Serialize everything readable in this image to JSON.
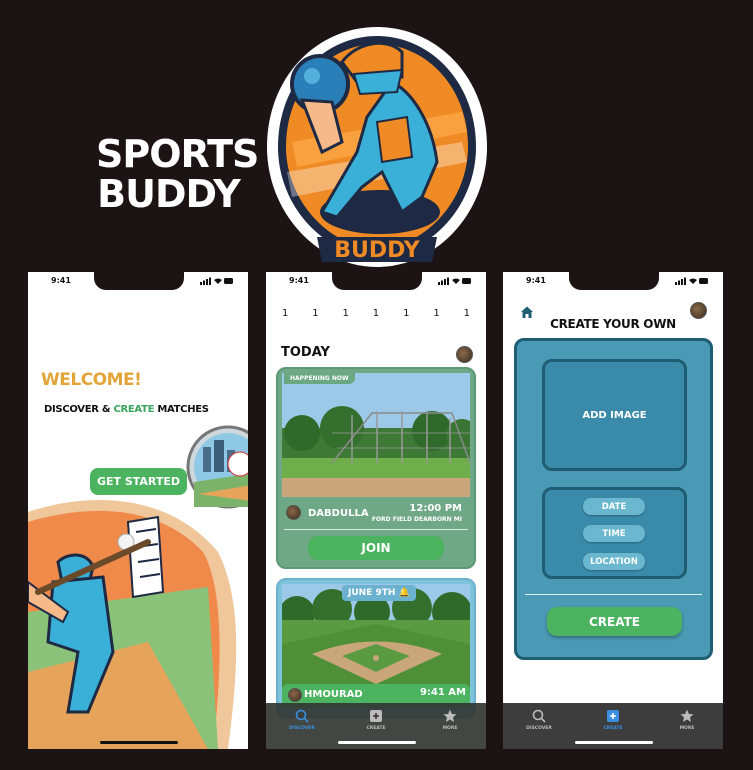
{
  "brand": {
    "title_line1": "SPORTS",
    "title_line2": "BUDDY",
    "logo_text": "BUDDY",
    "logo_colors": {
      "orange": "#f08a24",
      "blue": "#3ab0d8",
      "navy": "#1e2a44"
    }
  },
  "status_bar": {
    "time": "9:41"
  },
  "welcome_screen": {
    "heading": "WELCOME!",
    "tagline_part1": "DISCOVER & ",
    "tagline_highlight": "CREATE",
    "tagline_part2": " MATCHES",
    "cta_label": "GET STARTED"
  },
  "discover_screen": {
    "days": [
      "1",
      "1",
      "1",
      "1",
      "1",
      "1",
      "1"
    ],
    "section_title": "TODAY",
    "events": [
      {
        "badge": "HAPPENING NOW",
        "host": "DABDULLA",
        "time": "12:00 PM",
        "location": "FORD FIELD DEARBORN MI",
        "action_label": "JOIN"
      },
      {
        "date_label": "JUNE 9TH",
        "host": "HMOURAD",
        "time": "9:41 AM"
      }
    ]
  },
  "create_screen": {
    "title": "CREATE YOUR OWN",
    "add_image_label": "ADD IMAGE",
    "fields": [
      "DATE",
      "TIME",
      "LOCATION"
    ],
    "submit_label": "CREATE"
  },
  "tabs": [
    {
      "label": "DISCOVER",
      "icon": "search-icon"
    },
    {
      "label": "CREATE",
      "icon": "plus-square-icon"
    },
    {
      "label": "MORE",
      "icon": "star-icon"
    }
  ],
  "colors": {
    "background": "#1c1314",
    "accent_green": "#4cb461",
    "accent_orange": "#e3a53a",
    "panel_blue": "#4a9ab5",
    "active_tab": "#3a8fe0"
  }
}
